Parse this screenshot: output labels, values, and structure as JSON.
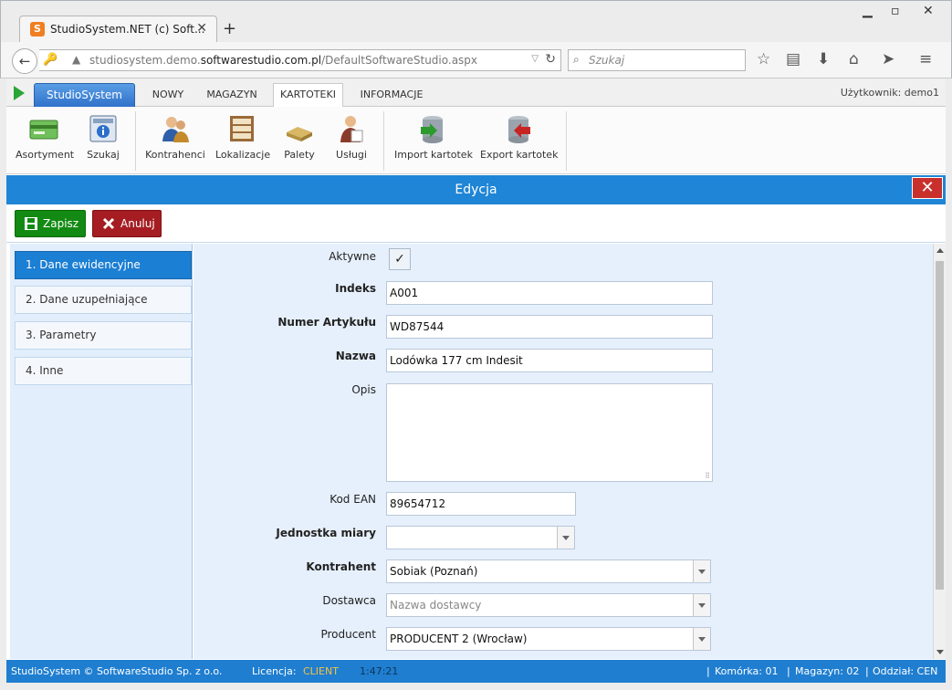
{
  "browser": {
    "tab_title": "StudioSystem.NET (c) Soft...",
    "favicon_letter": "S",
    "url_host_pre": "studiosystem.demo.",
    "url_host_main": "softwarestudio.com.pl",
    "url_path": "/DefaultSoftwareStudio.aspx",
    "search_placeholder": "Szukaj"
  },
  "app": {
    "brand": "StudioSystem",
    "menu": [
      "NOWY",
      "MAGAZYN",
      "KARTOTEKI",
      "INFORMACJE"
    ],
    "active_menu": "KARTOTEKI",
    "user_label": "Użytkownik: demo1"
  },
  "ribbon": {
    "groups": [
      [
        {
          "label": "Asortyment",
          "icon": "product-card-icon"
        },
        {
          "label": "Szukaj",
          "icon": "search-info-icon"
        }
      ],
      [
        {
          "label": "Kontrahenci",
          "icon": "contractors-icon"
        },
        {
          "label": "Lokalizacje",
          "icon": "shelves-icon"
        },
        {
          "label": "Palety",
          "icon": "pallet-icon"
        },
        {
          "label": "Usługi",
          "icon": "services-icon"
        }
      ],
      [
        {
          "label": "Import kartotek",
          "icon": "database-import-icon"
        },
        {
          "label": "Export kartotek",
          "icon": "database-export-icon"
        }
      ]
    ]
  },
  "dialog": {
    "title": "Edycja",
    "save_label": "Zapisz",
    "cancel_label": "Anuluj"
  },
  "sidebar": {
    "items": [
      "1. Dane ewidencyjne",
      "2. Dane uzupełniające",
      "3. Parametry",
      "4. Inne"
    ],
    "active_index": 0
  },
  "form": {
    "aktywne_label": "Aktywne",
    "aktywne_checked": true,
    "indeks_label": "Indeks",
    "indeks_value": "A001",
    "numer_label": "Numer Artykułu",
    "numer_value": "WD87544",
    "nazwa_label": "Nazwa",
    "nazwa_value": "Lodówka 177 cm Indesit",
    "opis_label": "Opis",
    "opis_value": "",
    "ean_label": "Kod EAN",
    "ean_value": "89654712",
    "jm_label": "Jednostka miary",
    "jm_value": "",
    "kontrahent_label": "Kontrahent",
    "kontrahent_value": "Sobiak (Poznań)",
    "dostawca_label": "Dostawca",
    "dostawca_placeholder": "Nazwa dostawcy",
    "producent_label": "Producent",
    "producent_value": "PRODUCENT 2 (Wrocław)"
  },
  "status": {
    "copyright": "StudioSystem © SoftwareStudio Sp. z o.o.",
    "licencja_label": "Licencja:",
    "licencja_value": "CLIENT",
    "time": "1:47:21",
    "komorka": "Komórka: 01",
    "magazyn": "Magazyn: 02",
    "oddzial": "Oddział: CEN"
  },
  "colors": {
    "accent": "#1f85d6",
    "save": "#138a13",
    "cancel": "#a51d22",
    "license": "#f7c243"
  }
}
